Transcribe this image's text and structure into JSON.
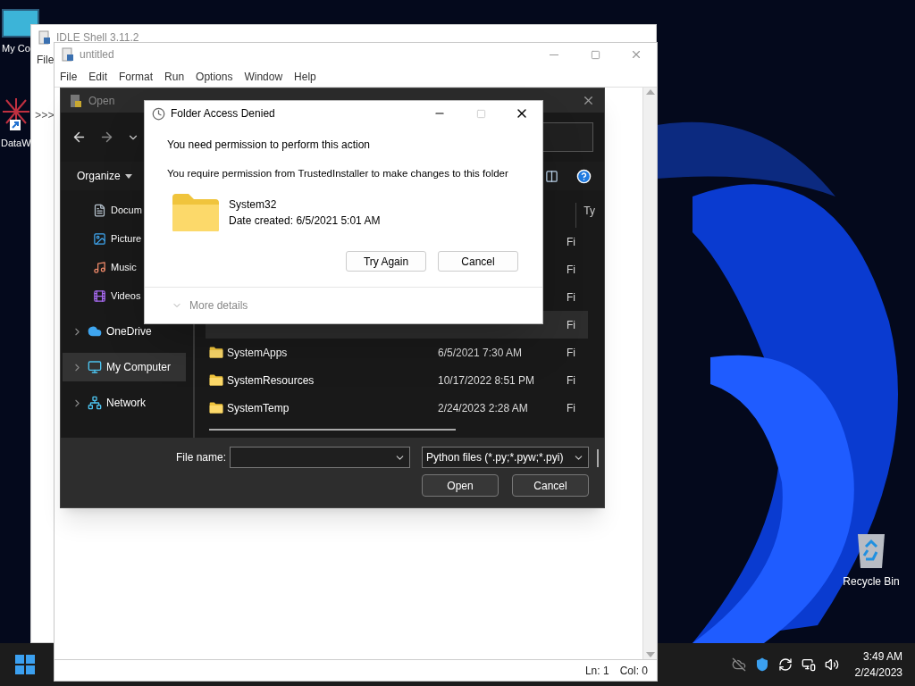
{
  "desktop": {
    "icons": [
      {
        "label": "My Co",
        "kind": "computer"
      },
      {
        "label": "DataW",
        "kind": "shortcut"
      },
      {
        "label": "Recycle Bin",
        "kind": "recycle"
      }
    ]
  },
  "idle_shell": {
    "title": "IDLE Shell 3.11.2",
    "menu": [
      "File"
    ],
    "prompt": ">>>"
  },
  "editor": {
    "title": "untitled",
    "menu": [
      "File",
      "Edit",
      "Format",
      "Run",
      "Options",
      "Window",
      "Help"
    ],
    "status": [
      "Ln: 1",
      "Col: 0"
    ]
  },
  "open_dialog": {
    "title": "Open",
    "organize": "Organize",
    "column_header": "Ty",
    "nav": [
      {
        "label": "Docum",
        "kind": "documents",
        "expandable": false,
        "selected": false
      },
      {
        "label": "Picture",
        "kind": "pictures",
        "expandable": false,
        "selected": false
      },
      {
        "label": "Music",
        "kind": "music",
        "expandable": false,
        "selected": false
      },
      {
        "label": "Videos",
        "kind": "videos",
        "expandable": false,
        "selected": false
      },
      {
        "label": "OneDrive",
        "kind": "cloud",
        "expandable": true,
        "selected": false
      },
      {
        "label": "My Computer",
        "kind": "computer",
        "expandable": true,
        "selected": true
      },
      {
        "label": "Network",
        "kind": "network",
        "expandable": true,
        "selected": false
      }
    ],
    "rows": [
      {
        "type": "Fi",
        "selected": false
      },
      {
        "type": "Fi",
        "selected": false
      },
      {
        "type": "Fi",
        "selected": false
      },
      {
        "type": "Fi",
        "selected": true
      },
      {
        "name": "SystemApps",
        "date": "6/5/2021 7:30 AM",
        "type": "Fi",
        "selected": false
      },
      {
        "name": "SystemResources",
        "date": "10/17/2022 8:51 PM",
        "type": "Fi",
        "selected": false
      },
      {
        "name": "SystemTemp",
        "date": "2/24/2023 2:28 AM",
        "type": "Fi",
        "selected": false
      }
    ],
    "file_name_label": "File name:",
    "file_type": "Python files (*.py;*.pyw;*.pyi)",
    "buttons": [
      "Open",
      "Cancel"
    ]
  },
  "access_dialog": {
    "title": "Folder Access Denied",
    "heading": "You need permission to perform this action",
    "message": "You require permission from TrustedInstaller to make changes to this folder",
    "folder_name": "System32",
    "date_created": "Date created: 6/5/2021 5:01 AM",
    "buttons": [
      "Try Again",
      "Cancel"
    ],
    "more_details": "More details",
    "maximize_disabled": true
  },
  "taskbar": {
    "time": "3:49 AM",
    "date": "2/24/2023"
  }
}
